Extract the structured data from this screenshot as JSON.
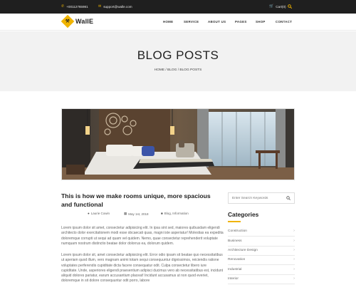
{
  "topbar": {
    "phone": "+00112765981",
    "email": "support@walle.com",
    "cart": "Cart(0)"
  },
  "header": {
    "logo": "WallE",
    "nav": [
      "HOME",
      "SERVICE",
      "ABOUT US",
      "PAGES",
      "SHOP",
      "CONTACT"
    ]
  },
  "banner": {
    "title": "BLOG POSTS",
    "breadcrumb": "HOME / BLOG / BLOG POSTS"
  },
  "post": {
    "title": "This is how we make rooms unique, more spacious and functional",
    "author": "Laurie Cowin",
    "date": "May 1st, 2018",
    "categories": "Blog, Information",
    "paragraphs": [
      "Lorem ipsum dolor sit amet, consectetur adipisicing elit. In ipsa sint sed, maiores quibusdam eligendi architecto dolor exercitationem modi esse obcaecati quas, magni iste asperiatur! Molestias ea expedita doloremque corrupti ut sequi ad quam vel quidem. Nemo, quae consectetur reprehenderit voluptate numquam nostrum distinctio beatae dolor dolorrus ea, dolorum quidem.",
      "Lorem ipsum dolor sit, amet consectetur adipisicing elit. Error odio ipsam sit beatae quo necessitatibus ut aperiam quod illum, vero magnam animi totam sequi consequuntur dignissimos, reiciendis ratione voluptates perferendis cupiditate dicta facere consequatur odit. Culpa consectetur libero iure cupiditate. Unde, asperiores eligendi praesentium adipisci ducimus vero ab necessitatibus est, incidunt aliquid dolores pariatur, earum accusantium placeat! Incidunt accusamus ut non quod everiet, doloremque in sit dolore consequuntur odit porro, labore"
    ]
  },
  "sidebar": {
    "search_placeholder": "Enter Search Keywords",
    "categories_title": "Categories",
    "categories": [
      "Construction",
      "Business",
      "Architecture Design",
      "Renovation",
      "Industrial",
      "Interior"
    ]
  },
  "colors": {
    "accent": "#f0b400",
    "topbar": "#1f1f1f",
    "banner": "#f2f2f2"
  },
  "icons": {
    "phone": "phone-icon",
    "email": "envelope-icon",
    "cart": "cart-icon",
    "search": "search-icon",
    "author": "user-icon",
    "date": "calendar-icon",
    "categories": "folder-icon"
  }
}
